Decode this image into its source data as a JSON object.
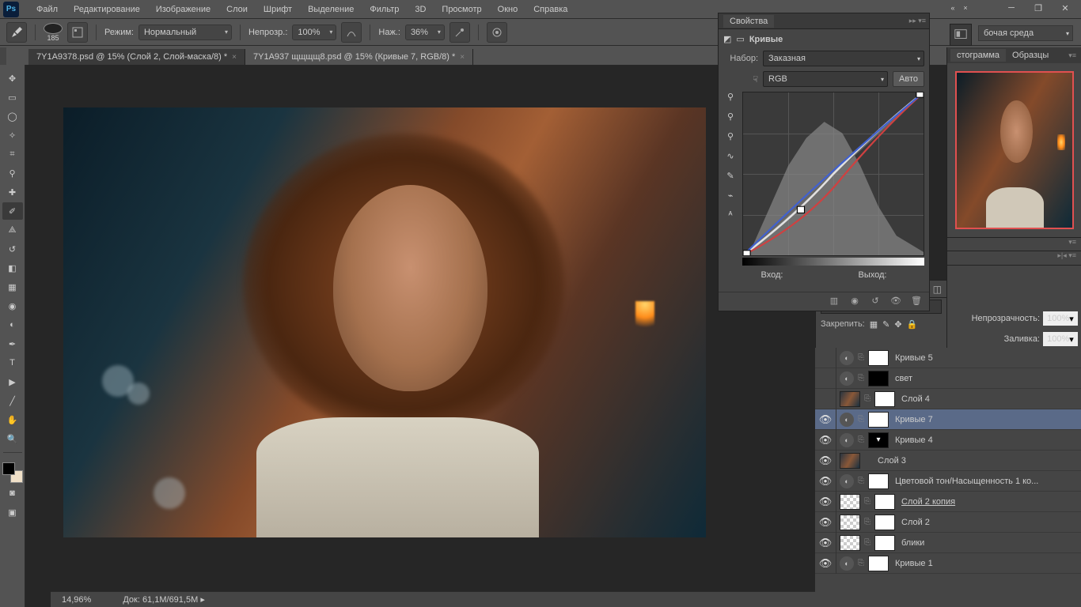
{
  "menu": {
    "items": [
      "Файл",
      "Редактирование",
      "Изображение",
      "Слои",
      "Шрифт",
      "Выделение",
      "Фильтр",
      "3D",
      "Просмотр",
      "Окно",
      "Справка"
    ]
  },
  "options": {
    "brush_size": "185",
    "mode_label": "Режим:",
    "mode_value": "Нормальный",
    "opacity_label": "Непрозр.:",
    "opacity_value": "100%",
    "flow_label": "Наж.:",
    "flow_value": "36%"
  },
  "workspace": {
    "label": "бочая среда",
    "expand_icon": "▸▸"
  },
  "tabs": [
    {
      "title": "7Y1A9378.psd @ 15% (Слой 2, Слой-маска/8) *",
      "active": false
    },
    {
      "title": "7Y1A937 щщщщ8.psd @ 15% (Кривые 7, RGB/8) *",
      "active": true
    }
  ],
  "status": {
    "zoom": "14,96%",
    "doc_label": "Док:",
    "doc_value": "61,1M/691,5M"
  },
  "properties": {
    "panel_title": "Свойства",
    "adj_title": "Кривые",
    "preset_label": "Набор:",
    "preset_value": "Заказная",
    "channel_value": "RGB",
    "auto_label": "Авто",
    "input_label": "Вход:",
    "output_label": "Выход:"
  },
  "navigator": {
    "tab_hist": "стограмма",
    "tab_swatch": "Образцы"
  },
  "layers_opts": {
    "opacity_label": "Непрозрачность:",
    "opacity_value": "100%",
    "lock_label": "Закрепить:",
    "fill_label": "Заливка:",
    "fill_value": "100%"
  },
  "layers": [
    {
      "eye": false,
      "adj": true,
      "thumb1": "adj",
      "thumb2": "white",
      "name": "Кривые 5"
    },
    {
      "eye": false,
      "adj": true,
      "thumb1": "adj",
      "thumb2": "black",
      "name": "свет"
    },
    {
      "eye": false,
      "adj": false,
      "thumb1": "img",
      "thumb2": "white",
      "name": "Слой 4",
      "mask2": true
    },
    {
      "eye": true,
      "adj": true,
      "thumb1": "adj",
      "thumb2": "white",
      "name": "Кривые 7",
      "selected": true
    },
    {
      "eye": true,
      "adj": true,
      "thumb1": "adj",
      "thumb2": "black",
      "name": "Кривые 4",
      "maskicon": true
    },
    {
      "eye": true,
      "adj": false,
      "thumb1": "img",
      "thumb2": "",
      "name": "Слой 3"
    },
    {
      "eye": true,
      "adj": true,
      "thumb1": "adj",
      "thumb2": "white",
      "name": "Цветовой тон/Насыщенность 1 ко..."
    },
    {
      "eye": true,
      "adj": false,
      "thumb1": "checker",
      "thumb2": "white",
      "name": "Слой 2 копия",
      "underline": true
    },
    {
      "eye": true,
      "adj": false,
      "thumb1": "checker",
      "thumb2": "white",
      "name": "Слой 2"
    },
    {
      "eye": true,
      "adj": false,
      "thumb1": "checker",
      "thumb2": "white",
      "name": "блики"
    },
    {
      "eye": true,
      "adj": true,
      "thumb1": "adj",
      "thumb2": "white",
      "name": "Кривые 1"
    }
  ]
}
